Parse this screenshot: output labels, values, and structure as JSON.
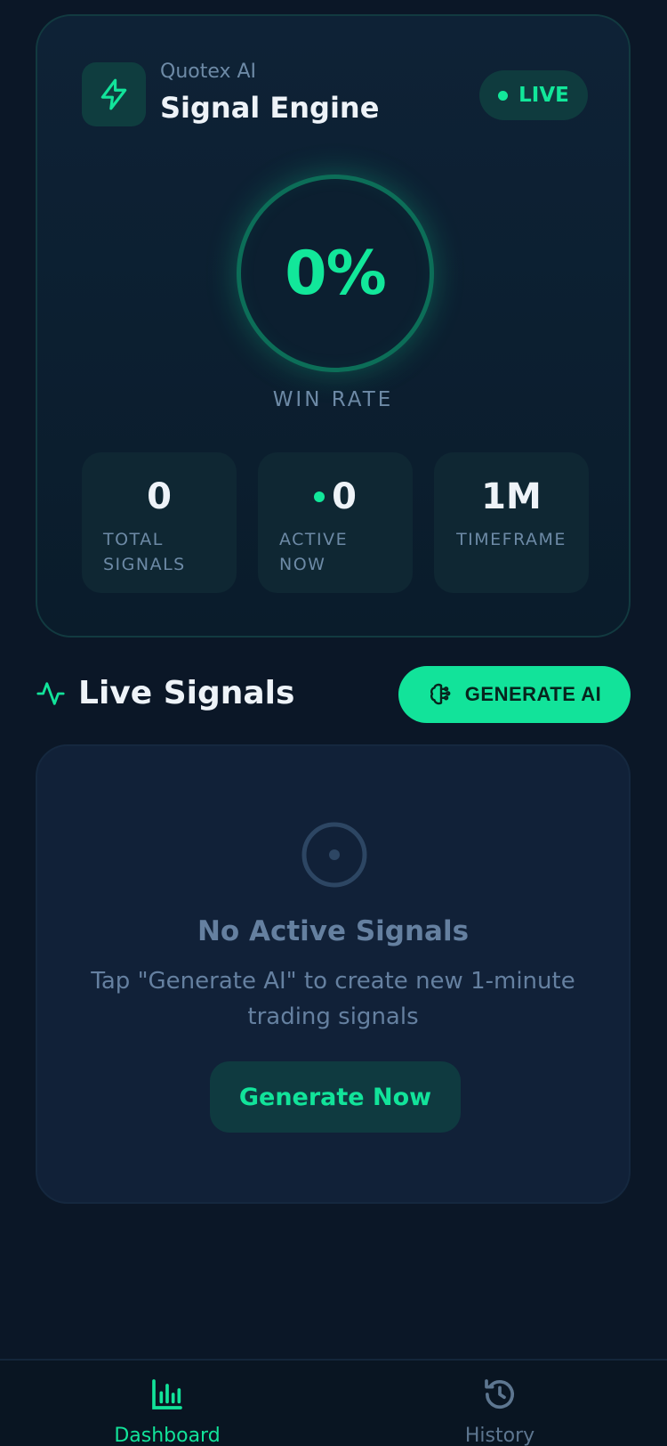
{
  "colors": {
    "accent": "#12e39a",
    "background": "#0b1727",
    "muted_text": "#6d8aa6"
  },
  "header": {
    "icon": "lightning-icon",
    "subtitle": "Quotex AI",
    "title": "Signal Engine",
    "status_badge": "LIVE"
  },
  "win_rate": {
    "value": "0%",
    "label": "WIN RATE"
  },
  "stats": [
    {
      "value": "0",
      "label": "TOTAL SIGNALS"
    },
    {
      "value": "0",
      "label": "ACTIVE NOW"
    },
    {
      "value": "1M",
      "label": "TIMEFRAME"
    }
  ],
  "signals": {
    "section_icon": "activity-pulse-icon",
    "section_title": "Live Signals",
    "generate_button_icon": "brain-icon",
    "generate_button_label": "GENERATE AI",
    "empty_icon": "target-icon",
    "empty_title": "No Active Signals",
    "empty_description": "Tap \"Generate AI\" to create new 1-minute trading signals",
    "generate_now_label": "Generate Now"
  },
  "nav": {
    "items": [
      {
        "icon": "bar-chart-icon",
        "label": "Dashboard",
        "active": true
      },
      {
        "icon": "history-icon",
        "label": "History",
        "active": false
      }
    ]
  }
}
